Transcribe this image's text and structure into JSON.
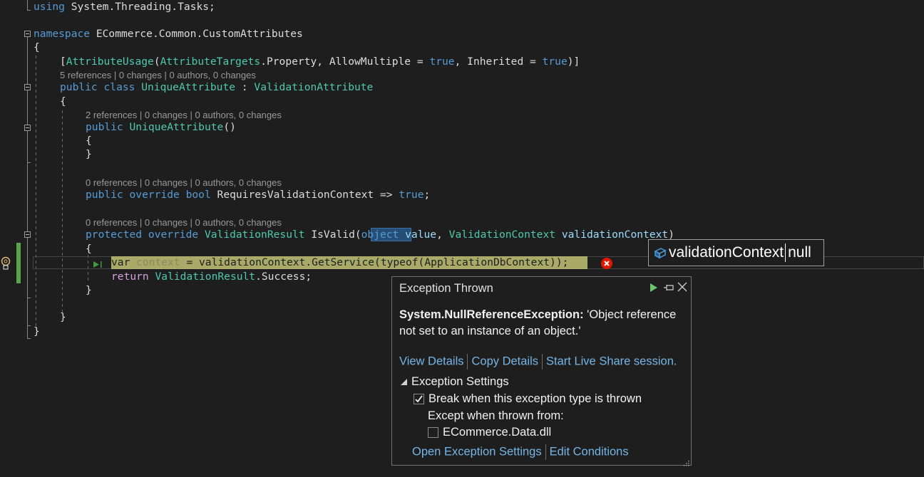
{
  "editor": {
    "lines": {
      "using": {
        "kw": "using",
        "rest": " System.Threading.Tasks;"
      },
      "namespace": {
        "kw": "namespace",
        "rest": " ECommerce.Common.CustomAttributes"
      },
      "open_brace_ns": "{",
      "attribute": {
        "open": "[",
        "type1": "AttributeUsage",
        "p1": "(",
        "type2": "AttributeTargets",
        "p2": ".Property, AllowMultiple = ",
        "val1": "true",
        "p3": ", Inherited = ",
        "val2": "true",
        "close": ")]"
      },
      "class_decl": {
        "kw1": "public",
        "kw2": "class",
        "name": "UniqueAttribute",
        "colon": " : ",
        "base": "ValidationAttribute"
      },
      "open_brace_class": "{",
      "ctor_decl": {
        "kw": "public",
        "name": "UniqueAttribute",
        "rest": "()"
      },
      "ctor_open": "{",
      "ctor_close": "}",
      "prop_decl": {
        "kw1": "public",
        "kw2": "override",
        "kw3": "bool",
        "name": " RequiresValidationContext => ",
        "val": "true",
        "end": ";"
      },
      "method_decl": {
        "kw1": "protected",
        "kw2": "override",
        "ret": "ValidationResult",
        "name": " IsValid(",
        "ptype1": "object",
        "pname1": " value",
        "comma": ", ",
        "ptype2": "ValidationContext",
        "pname2": " validationContext",
        "close": ")"
      },
      "method_open": "{",
      "exec_line": {
        "kw": "var",
        "var": " context",
        "rest": " = validationContext.GetService(typeof(ApplicationDbContext));"
      },
      "return_line": {
        "kw": "return",
        "type": " ValidationResult",
        "rest": ".Success;"
      },
      "method_close": "}",
      "class_close": "}",
      "ns_close": "}"
    },
    "codelens": {
      "class": "5 references | 0 changes | 0 authors, 0 changes",
      "ctor": "2 references | 0 changes | 0 authors, 0 changes",
      "prop": "0 references | 0 changes | 0 authors, 0 changes",
      "method": "0 references | 0 changes | 0 authors, 0 changes"
    }
  },
  "datatip": {
    "name": "validationContext",
    "value": "null"
  },
  "exception_popup": {
    "title": "Exception Thrown",
    "exception_type": "System.NullReferenceException:",
    "message": " 'Object reference not set to an instance of an object.'",
    "links": [
      "View Details",
      "Copy Details",
      "Start Live Share session."
    ],
    "settings_header": "Exception Settings",
    "break_when_label": "Break when this exception type is thrown",
    "break_when_checked": true,
    "except_when_label": "Except when thrown from:",
    "except_module_label": "ECommerce.Data.dll",
    "except_module_checked": false,
    "bottom_links": [
      "Open Exception Settings",
      "Edit Conditions"
    ]
  },
  "colors": {
    "background": "#1e1e1e",
    "keyword": "#569cd6",
    "type": "#4ec9b0",
    "link": "#75b6e7",
    "error": "#e51400",
    "changed_line": "#57a64a",
    "continue_green": "#6cc66c"
  }
}
